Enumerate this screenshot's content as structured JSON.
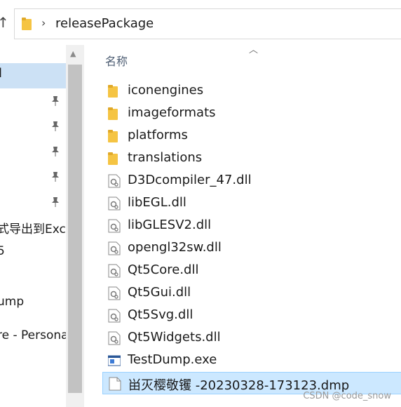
{
  "address": {
    "path": "releasePackage"
  },
  "nav": {
    "selected_fragment": "l",
    "items": [
      {
        "label": ""
      },
      {
        "label": ""
      },
      {
        "label": ""
      },
      {
        "label": ""
      },
      {
        "label": ""
      },
      {
        "label": "式导出到Exc"
      },
      {
        "label": "5"
      },
      {
        "label": "ump"
      },
      {
        "label": "re - Persona"
      }
    ]
  },
  "list": {
    "header": "名称",
    "files": [
      {
        "name": "iconengines",
        "type": "folder"
      },
      {
        "name": "imageformats",
        "type": "folder"
      },
      {
        "name": "platforms",
        "type": "folder"
      },
      {
        "name": "translations",
        "type": "folder"
      },
      {
        "name": "D3Dcompiler_47.dll",
        "type": "dll"
      },
      {
        "name": "libEGL.dll",
        "type": "dll"
      },
      {
        "name": "libGLESV2.dll",
        "type": "dll"
      },
      {
        "name": "opengl32sw.dll",
        "type": "dll"
      },
      {
        "name": "Qt5Core.dll",
        "type": "dll"
      },
      {
        "name": "Qt5Gui.dll",
        "type": "dll"
      },
      {
        "name": "Qt5Svg.dll",
        "type": "dll"
      },
      {
        "name": "Qt5Widgets.dll",
        "type": "dll"
      },
      {
        "name": "TestDump.exe",
        "type": "exe"
      },
      {
        "name": "畄灭樱敬䦆 -20230328-173123.dmp",
        "type": "file",
        "selected": true
      }
    ]
  },
  "watermark": "CSDN @code_snow"
}
